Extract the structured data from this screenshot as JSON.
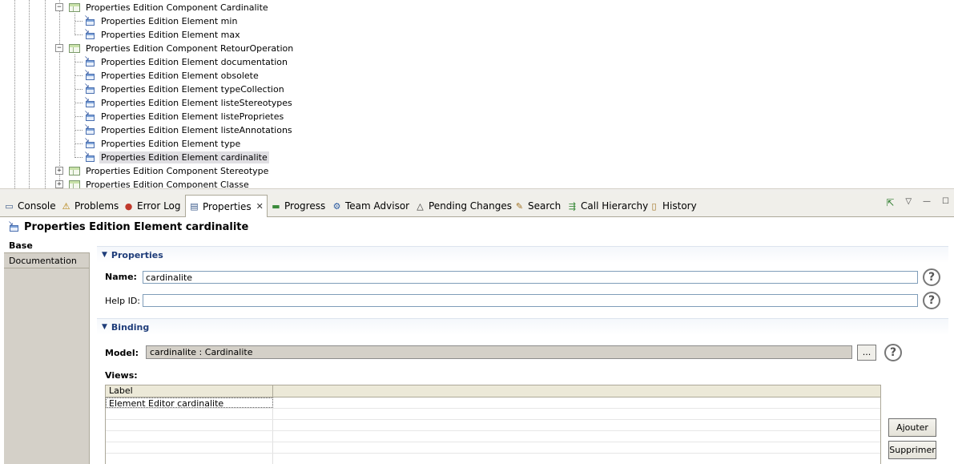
{
  "tree": {
    "rows": [
      {
        "label": "Properties Edition Component Cardinalite",
        "kind": "component",
        "expander": "−"
      },
      {
        "label": "Properties Edition Element min",
        "kind": "element"
      },
      {
        "label": "Properties Edition Element max",
        "kind": "element"
      },
      {
        "label": "Properties Edition Component RetourOperation",
        "kind": "component",
        "expander": "−"
      },
      {
        "label": "Properties Edition Element documentation",
        "kind": "element"
      },
      {
        "label": "Properties Edition Element obsolete",
        "kind": "element"
      },
      {
        "label": "Properties Edition Element typeCollection",
        "kind": "element"
      },
      {
        "label": "Properties Edition Element listeStereotypes",
        "kind": "element"
      },
      {
        "label": "Properties Edition Element listeProprietes",
        "kind": "element"
      },
      {
        "label": "Properties Edition Element listeAnnotations",
        "kind": "element"
      },
      {
        "label": "Properties Edition Element type",
        "kind": "element"
      },
      {
        "label": "Properties Edition Element cardinalite",
        "kind": "element",
        "selected": true
      },
      {
        "label": "Properties Edition Component Stereotype",
        "kind": "component",
        "expander": "+"
      },
      {
        "label": "Properties Edition Component Classe",
        "kind": "component",
        "expander": "+"
      }
    ]
  },
  "tabs": [
    {
      "label": "Console",
      "icon": "console-icon",
      "glyph": "▭",
      "color": "#3a5a8a"
    },
    {
      "label": "Problems",
      "icon": "problems-icon",
      "glyph": "⚠",
      "color": "#b07a00"
    },
    {
      "label": "Error Log",
      "icon": "error-log-icon",
      "glyph": "●",
      "color": "#c0392b"
    },
    {
      "label": "Properties",
      "icon": "properties-icon",
      "glyph": "▤",
      "color": "#3a5a8a",
      "active": true,
      "close": "✕"
    },
    {
      "label": "Progress",
      "icon": "progress-icon",
      "glyph": "▬",
      "color": "#3a8a3a"
    },
    {
      "label": "Team Advisor",
      "icon": "team-advisor-icon",
      "glyph": "⚙",
      "color": "#2a5aa0"
    },
    {
      "label": "Pending Changes",
      "icon": "pending-changes-icon",
      "glyph": "△",
      "color": "#333"
    },
    {
      "label": "Search",
      "icon": "search-icon",
      "glyph": "✎",
      "color": "#a07020"
    },
    {
      "label": "Call Hierarchy",
      "icon": "call-hierarchy-icon",
      "glyph": "⇶",
      "color": "#3a8a3a"
    },
    {
      "label": "History",
      "icon": "history-icon",
      "glyph": "▯",
      "color": "#a07020"
    }
  ],
  "view_controls": {
    "pin": "⇱",
    "menu": "▽",
    "minimize": "—",
    "maximize": "☐"
  },
  "view_title": "Properties Edition Element cardinalite",
  "left_tabs": [
    {
      "label": "Base",
      "active": true
    },
    {
      "label": "Documentation"
    }
  ],
  "properties_section": {
    "title": "Properties",
    "name_label": "Name:",
    "name_value": "cardinalite",
    "helpid_label": "Help ID:",
    "helpid_value": ""
  },
  "binding_section": {
    "title": "Binding",
    "model_label": "Model:",
    "model_value": "cardinalite : Cardinalite",
    "browse_label": "...",
    "views_label": "Views:",
    "table_header": "Label",
    "table_rows": [
      "Element Editor cardinalite",
      "",
      "",
      "",
      "",
      ""
    ],
    "add_button": "Ajouter",
    "remove_button": "Supprimer"
  },
  "help_glyph": "?"
}
